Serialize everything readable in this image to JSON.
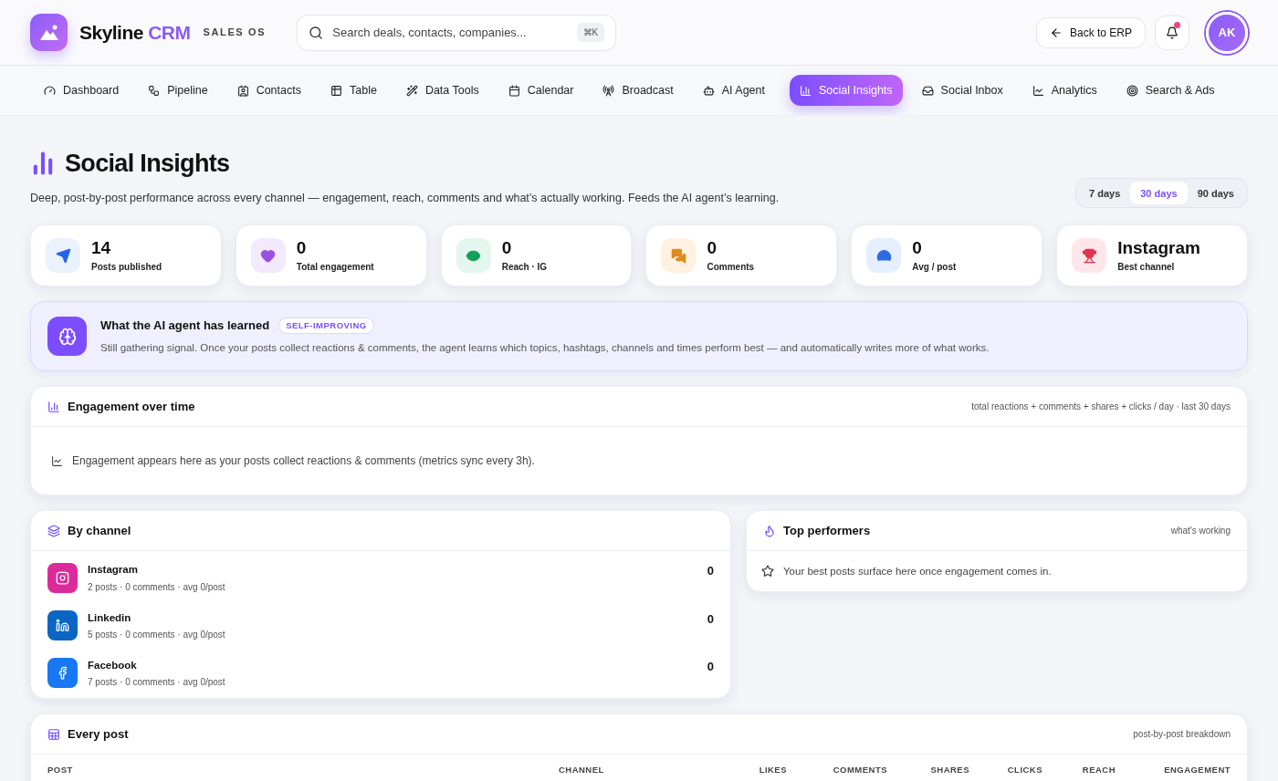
{
  "brand": {
    "name": "Skyline",
    "accent": "CRM",
    "tagline": "SALES OS"
  },
  "search": {
    "placeholder": "Search deals, contacts, companies...",
    "shortcut": "⌘K"
  },
  "header": {
    "back_button": "Back to ERP",
    "notifications_unread": true,
    "avatar": "AK"
  },
  "nav": [
    {
      "label": "Dashboard",
      "selected": false
    },
    {
      "label": "Pipeline",
      "selected": false
    },
    {
      "label": "Contacts",
      "selected": false
    },
    {
      "label": "Table",
      "selected": false
    },
    {
      "label": "Data Tools",
      "selected": false
    },
    {
      "label": "Calendar",
      "selected": false
    },
    {
      "label": "Broadcast",
      "selected": false
    },
    {
      "label": "AI Agent",
      "selected": false
    },
    {
      "label": "Social Insights",
      "selected": true
    },
    {
      "label": "Social Inbox",
      "selected": false
    },
    {
      "label": "Analytics",
      "selected": false
    },
    {
      "label": "Search & Ads",
      "selected": false
    }
  ],
  "page": {
    "title": "Social Insights",
    "subtitle": "Deep, post-by-post performance across every channel — engagement, reach, comments and what’s actually working. Feeds the AI agent’s learning."
  },
  "ranges": [
    {
      "label": "7 days",
      "selected": false
    },
    {
      "label": "30 days",
      "selected": true
    },
    {
      "label": "90 days",
      "selected": false
    }
  ],
  "stats": [
    {
      "value": "14",
      "label": "Posts published"
    },
    {
      "value": "0",
      "label": "Total engagement"
    },
    {
      "value": "0",
      "label": "Reach · IG"
    },
    {
      "value": "0",
      "label": "Comments"
    },
    {
      "value": "0",
      "label": "Avg / post"
    },
    {
      "value": "Instagram",
      "label": "Best channel"
    }
  ],
  "learning": {
    "title": "What the AI agent has learned",
    "badge": "SELF-IMPROVING",
    "text": "Still gathering signal. Once your posts collect reactions & comments, the agent learns which topics, hashtags, channels and times perform best — and automatically writes more of what works."
  },
  "engagement": {
    "title": "Engagement over time",
    "note": "total reactions + comments + shares + clicks / day · last 30 days",
    "empty": "Engagement appears here as your posts collect reactions & comments (metrics sync every 3h)."
  },
  "by_channel": {
    "title": "By channel",
    "channels": [
      {
        "name": "Instagram",
        "color": "#dd2a9b",
        "detail": "2 posts · 0 comments · avg 0/post",
        "value": "0"
      },
      {
        "name": "Linkedin",
        "color": "#0a66c2",
        "detail": "5 posts · 0 comments · avg 0/post",
        "value": "0"
      },
      {
        "name": "Facebook",
        "color": "#1877f2",
        "detail": "7 posts · 0 comments · avg 0/post",
        "value": "0"
      }
    ]
  },
  "top_performers": {
    "title": "Top performers",
    "note": "what's working",
    "empty": "Your best posts surface here once engagement comes in."
  },
  "every_post": {
    "title": "Every post",
    "note": "post-by-post breakdown",
    "columns": [
      "POST",
      "CHANNEL",
      "LIKES",
      "COMMENTS",
      "SHARES",
      "CLICKS",
      "REACH",
      "ENGAGEMENT"
    ]
  }
}
